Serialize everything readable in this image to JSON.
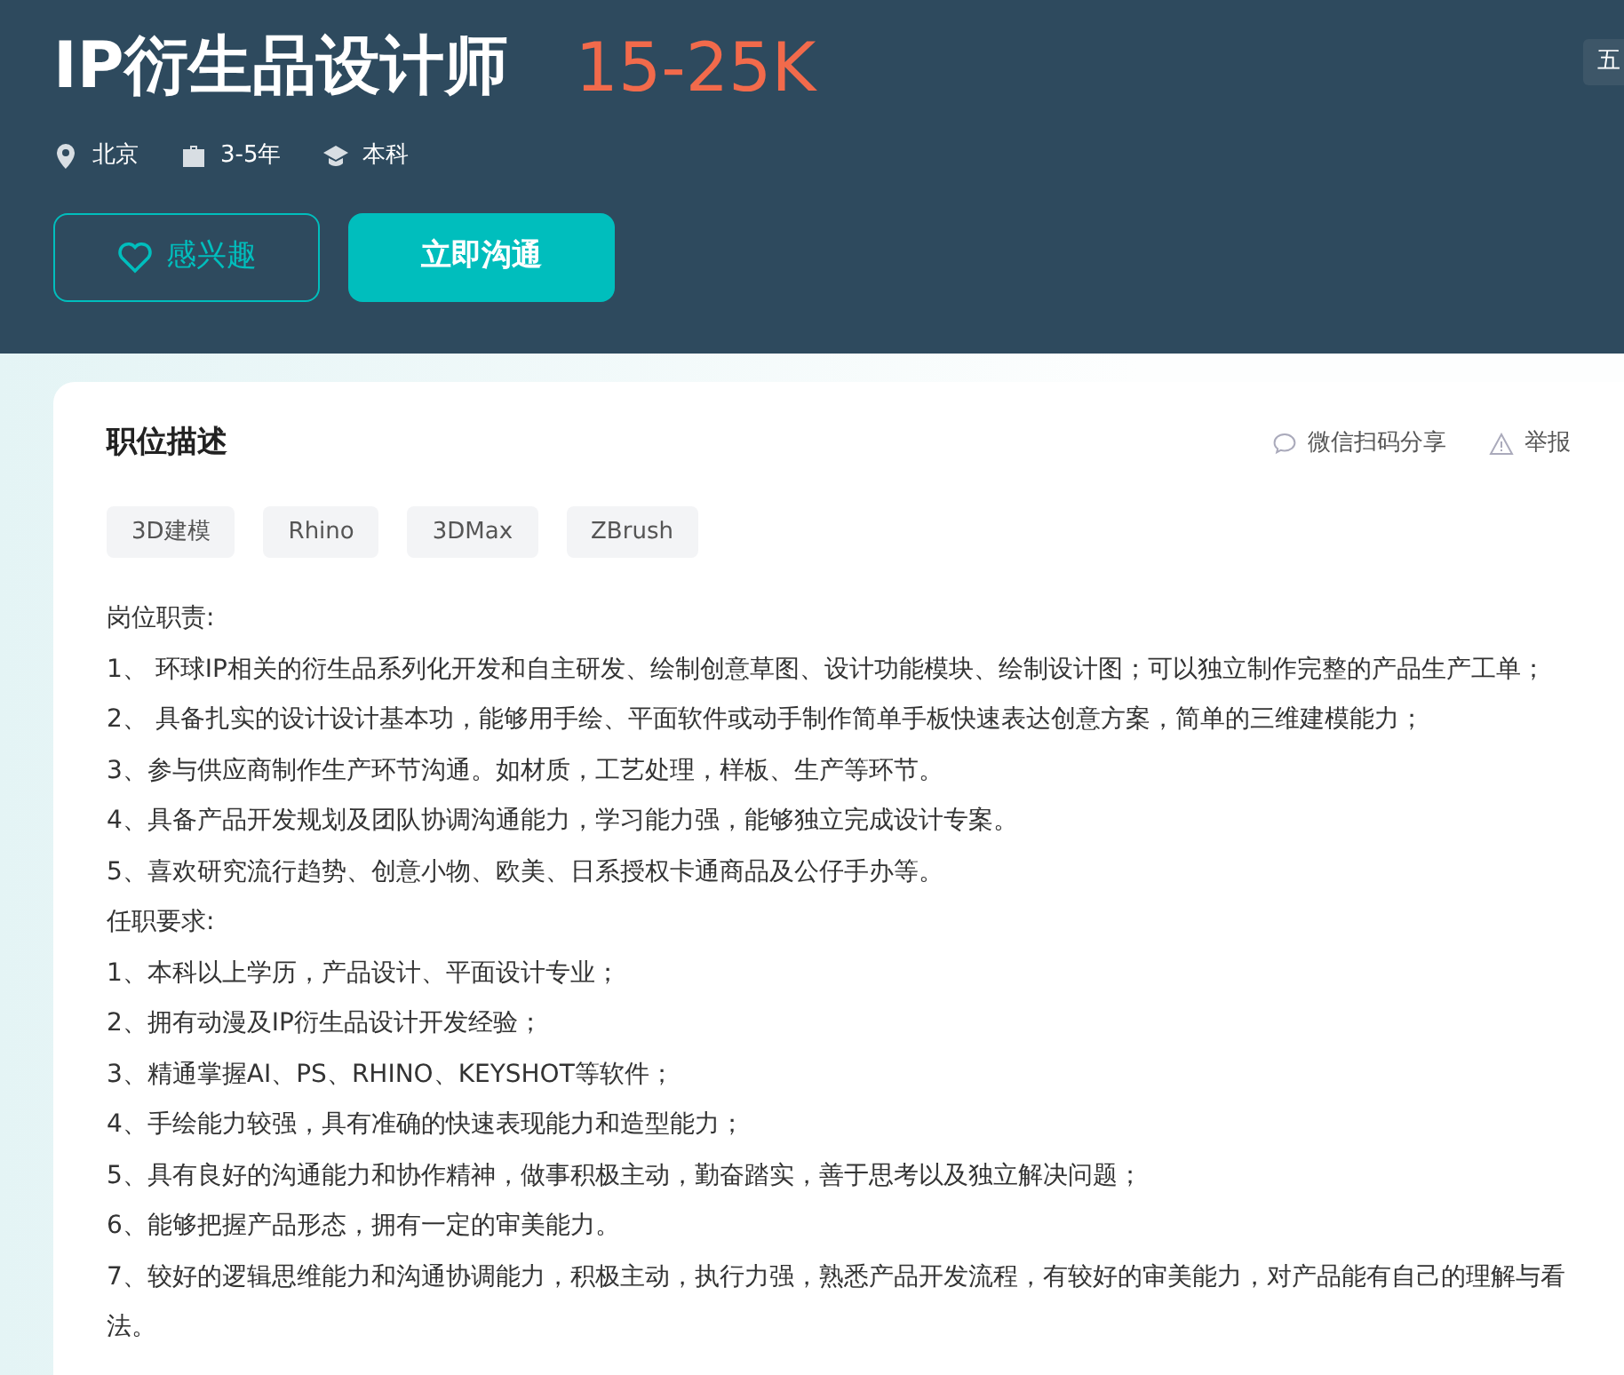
{
  "job": {
    "title": "IP衍生品设计师",
    "salary": "15-25K",
    "side_tag": "五",
    "meta": [
      {
        "kind": "location",
        "text": "北京"
      },
      {
        "kind": "experience",
        "text": "3-5年"
      },
      {
        "kind": "education",
        "text": "本科"
      }
    ],
    "buttons": [
      {
        "kind": "outline",
        "label": "感兴趣"
      },
      {
        "kind": "primary",
        "label": "立即沟通"
      }
    ]
  },
  "description": {
    "title": "职位描述",
    "actions": [
      {
        "kind": "share",
        "label": "微信扫码分享"
      },
      {
        "kind": "report",
        "label": "举报"
      }
    ],
    "tags": [
      "3D建模",
      "Rhino",
      "3DMax",
      "ZBrush"
    ],
    "lines": [
      "岗位职责:",
      "1、 环球IP相关的衍生品系列化开发和自主研发、绘制创意草图、设计功能模块、绘制设计图；可以独立制作完整的产品生产工单；",
      "2、 具备扎实的设计设计基本功，能够用手绘、平面软件或动手制作简单手板快速表达创意方案，简单的三维建模能力；",
      "3、参与供应商制作生产环节沟通。如材质，工艺处理，样板、生产等环节。",
      "4、具备产品开发规划及团队协调沟通能力，学习能力强，能够独立完成设计专案。",
      "5、喜欢研究流行趋势、创意小物、欧美、日系授权卡通商品及公仔手办等。",
      "任职要求:",
      "1、本科以上学历，产品设计、平面设计专业；",
      "2、拥有动漫及IP衍生品设计开发经验；",
      "3、精通掌握AI、PS、RHINO、KEYSHOT等软件；",
      "4、手绘能力较强，具有准确的快速表现能力和造型能力；",
      "5、具有良好的沟通能力和协作精神，做事积极主动，勤奋踏实，善于思考以及独立解决问题；",
      "6、能够把握产品形态，拥有一定的审美能力。",
      "7、较好的逻辑思维能力和沟通协调能力，积极主动，执行力强，熟悉产品开发流程，有较好的审美能力，对产品能有自己的理解与看法。"
    ]
  }
}
